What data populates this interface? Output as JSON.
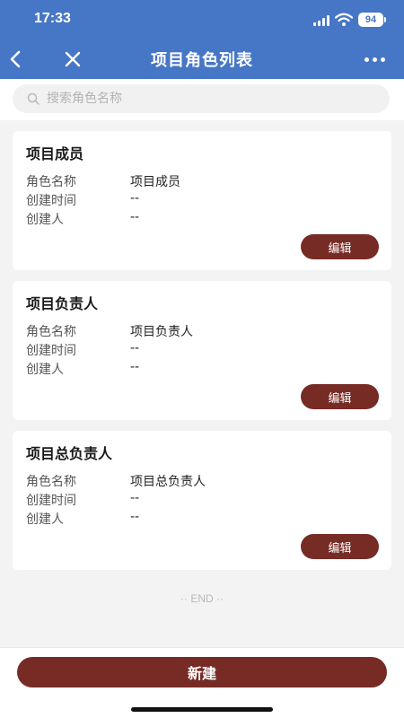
{
  "status": {
    "time": "17:33",
    "battery": "94"
  },
  "nav": {
    "title": "项目角色列表"
  },
  "search": {
    "placeholder": "搜索角色名称"
  },
  "labels": {
    "role_name": "角色名称",
    "created_time": "创建时间",
    "creator": "创建人",
    "edit": "编辑"
  },
  "cards": [
    {
      "title": "项目成员",
      "role_name": "项目成员",
      "created_time": "--",
      "creator": "--"
    },
    {
      "title": "项目负责人",
      "role_name": "项目负责人",
      "created_time": "--",
      "creator": "--"
    },
    {
      "title": "项目总负责人",
      "role_name": "项目总负责人",
      "created_time": "--",
      "creator": "--"
    }
  ],
  "list_end": "·· END ··",
  "footer": {
    "new_label": "新建"
  },
  "colors": {
    "nav_bg": "#4676c6",
    "primary_button": "#772b25"
  }
}
